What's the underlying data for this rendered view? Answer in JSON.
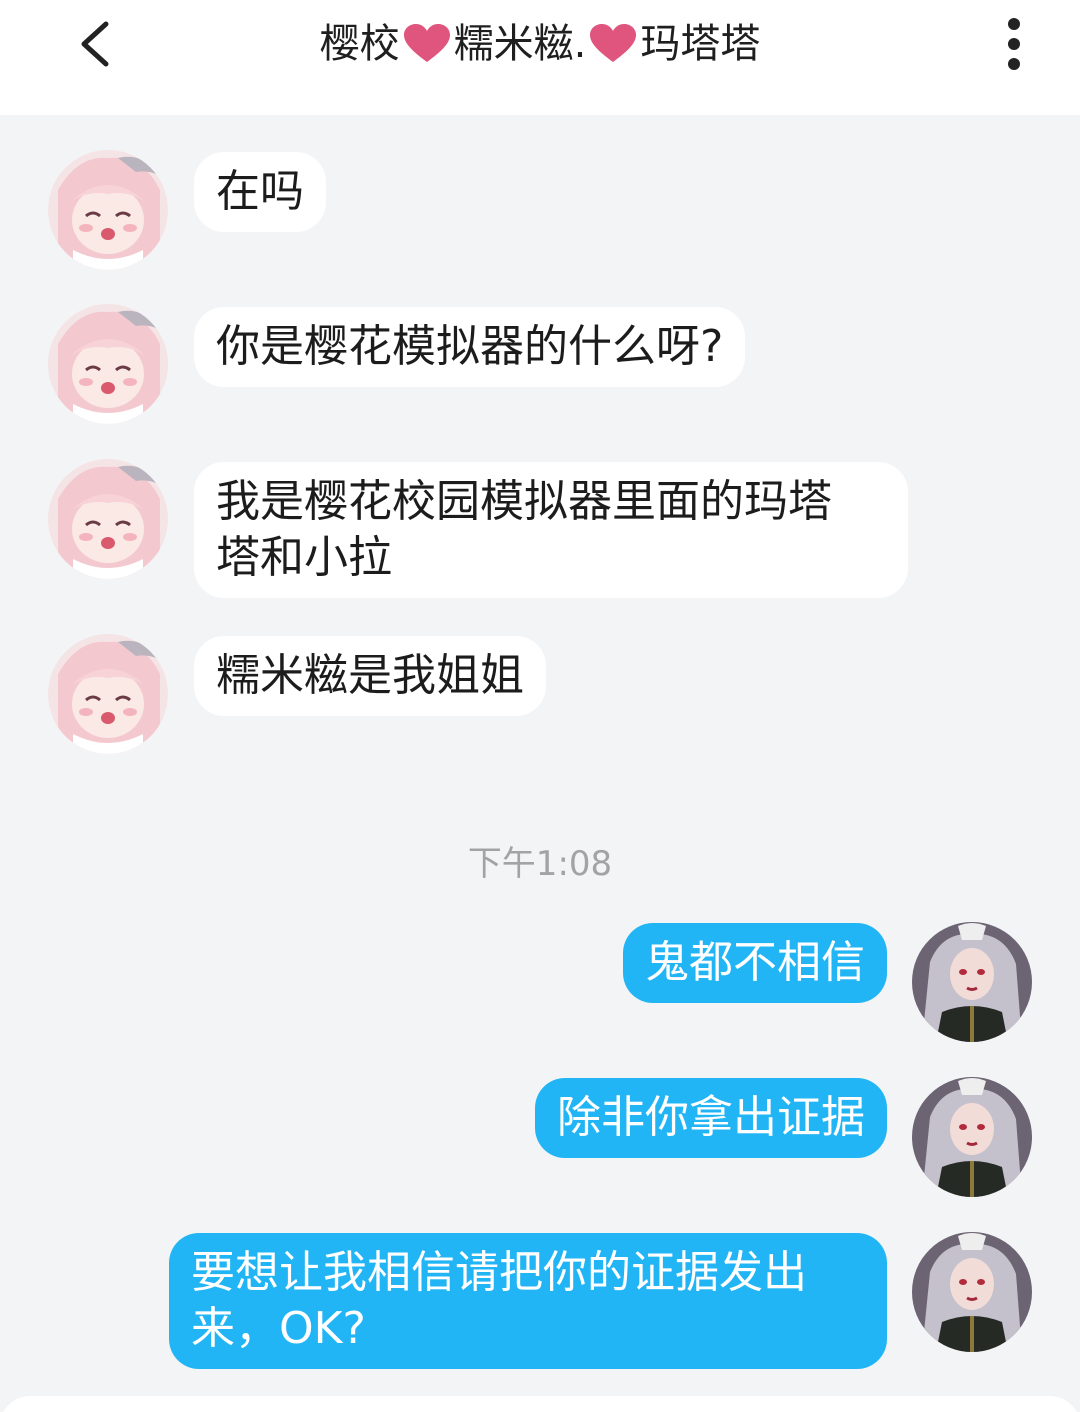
{
  "header": {
    "title_part1": "樱校",
    "title_part2": "糯米糍.",
    "title_part3": "玛塔塔",
    "heart_color": "#e0557e",
    "back_icon": "chevron-left-icon",
    "more_icon": "more-vertical-icon"
  },
  "incoming": [
    {
      "lines": [
        "在吗"
      ]
    },
    {
      "lines": [
        "你是樱花模拟器的什么呀?"
      ]
    },
    {
      "lines": [
        "我是樱花校园模拟器里面的玛塔",
        "塔和小拉"
      ]
    },
    {
      "lines": [
        "糯米糍是我姐姐"
      ]
    }
  ],
  "divider_time": "下午1:08",
  "outgoing": [
    {
      "lines": [
        "鬼都不相信"
      ]
    },
    {
      "lines": [
        "除非你拿出证据"
      ]
    },
    {
      "lines": [
        "要想让我相信请把你的证据发出",
        "来，OK?"
      ]
    }
  ],
  "colors": {
    "outgoing_bubble": "#22b5f5",
    "incoming_bubble": "#ffffff",
    "background": "#f3f4f6"
  }
}
